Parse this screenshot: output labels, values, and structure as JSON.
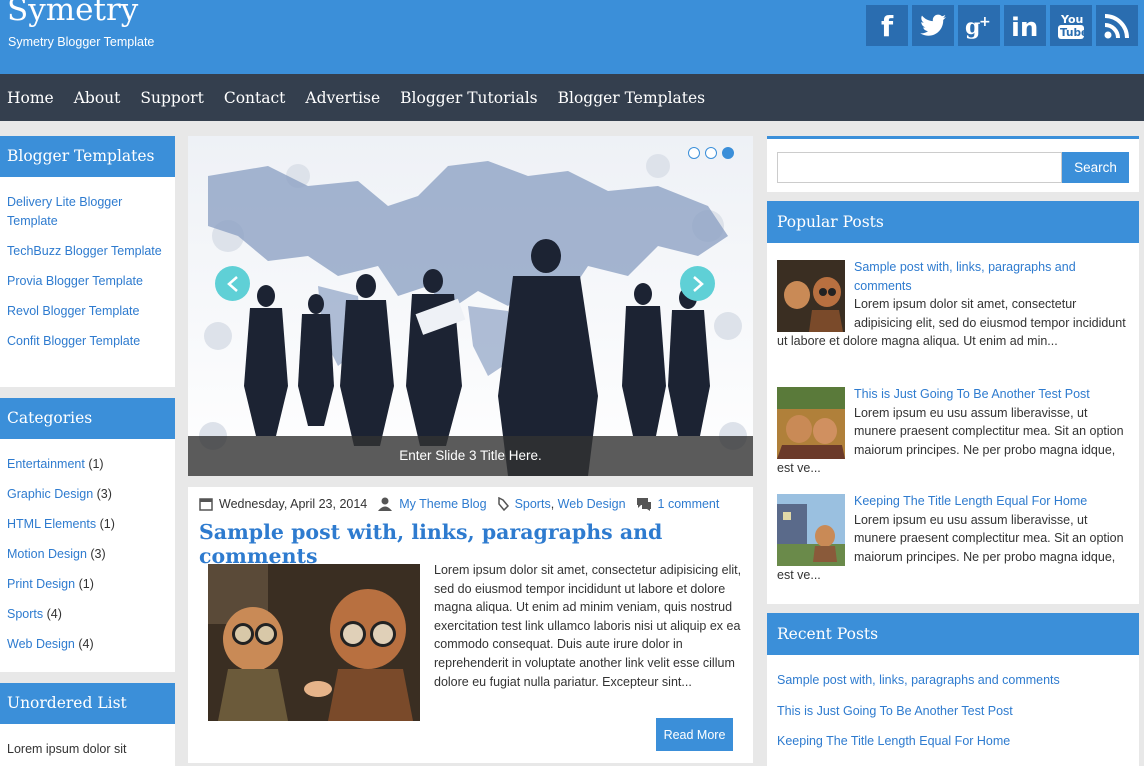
{
  "header": {
    "site_title": "Symetry",
    "site_description": "Symetry Blogger Template",
    "social": [
      {
        "label": "f",
        "icon": "facebook-icon"
      },
      {
        "label": "twitter",
        "icon": "twitter-icon"
      },
      {
        "label": "g+",
        "icon": "google-plus-icon"
      },
      {
        "label": "in",
        "icon": "linkedin-icon"
      },
      {
        "label": "You Tube",
        "icon": "youtube-icon"
      },
      {
        "label": "rss",
        "icon": "rss-icon"
      }
    ]
  },
  "nav": [
    "Home",
    "About",
    "Support",
    "Contact",
    "Advertise",
    "Blogger Tutorials",
    "Blogger Templates"
  ],
  "left": {
    "templates": {
      "title": "Blogger Templates",
      "items": [
        "Delivery Lite Blogger Template",
        "TechBuzz Blogger Template",
        "Provia Blogger Template",
        "Revol Blogger Template",
        "Confit Blogger Template"
      ]
    },
    "categories": {
      "title": "Categories",
      "items": [
        {
          "name": "Entertainment",
          "count": "(1)"
        },
        {
          "name": "Graphic Design",
          "count": "(3)"
        },
        {
          "name": "HTML Elements",
          "count": "(1)"
        },
        {
          "name": "Motion Design",
          "count": "(3)"
        },
        {
          "name": "Print Design",
          "count": "(1)"
        },
        {
          "name": "Sports",
          "count": "(4)"
        },
        {
          "name": "Web Design",
          "count": "(4)"
        }
      ]
    },
    "unordered": {
      "title": "Unordered List",
      "first_item": "Lorem ipsum dolor sit"
    }
  },
  "slider": {
    "caption": "Enter Slide 3 Title Here.",
    "dots": 3,
    "active_dot": 3
  },
  "post": {
    "date": "Wednesday, April 23, 2014",
    "author": "My Theme Blog",
    "labels": [
      "Sports",
      "Web Design"
    ],
    "label_sep": ",",
    "comments": "1 comment",
    "title": "Sample post with, links, paragraphs and comments",
    "excerpt": "Lorem ipsum dolor sit amet, consectetur adipisicing elit, sed do eiusmod tempor incididunt ut labore et dolore magna aliqua. Ut enim ad minim veniam, quis nostrud exercitation test link ullamco laboris nisi ut aliquip ex ea commodo consequat. Duis aute irure dolor in reprehenderit in voluptate another link velit esse cillum dolore eu fugiat nulla pariatur. Excepteur sint...",
    "read_more": "Read More"
  },
  "right": {
    "search": {
      "placeholder": "",
      "button": "Search"
    },
    "popular": {
      "title": "Popular Posts",
      "items": [
        {
          "title": "Sample post with, links, paragraphs and comments",
          "snippet": "Lorem ipsum dolor sit amet, consectetur adipisicing elit, sed do eiusmod tempor incididunt ut labore et dolore magna aliqua. Ut enim ad min..."
        },
        {
          "title": "This is Just Going To Be Another Test Post",
          "snippet": "Lorem ipsum eu usu assum liberavisse, ut munere praesent complectitur mea. Sit an option maiorum principes. Ne per probo magna idque, est ve..."
        },
        {
          "title": "Keeping The Title Length Equal For Home",
          "snippet": "Lorem ipsum eu usu assum liberavisse, ut munere praesent complectitur mea. Sit an option maiorum principes. Ne per probo magna idque, est ve..."
        }
      ]
    },
    "recent": {
      "title": "Recent Posts",
      "items": [
        "Sample post with, links, paragraphs and comments",
        "This is Just Going To Be Another Test Post",
        "Keeping The Title Length Equal For Home"
      ]
    }
  },
  "colors": {
    "accent": "#3b8fd9",
    "nav_bg": "#343f4e",
    "link": "#2e7bcf",
    "slider_arrow": "#5fd0d6"
  }
}
